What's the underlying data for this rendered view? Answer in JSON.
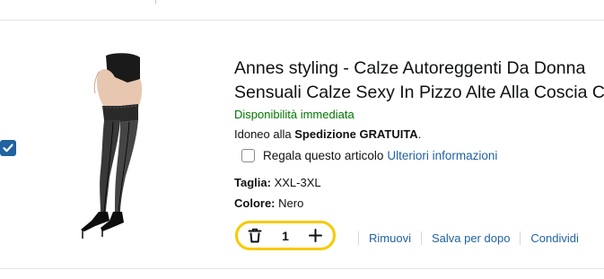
{
  "item": {
    "title_line1": "Annes styling - Calze Autoreggenti Da Donna",
    "title_line2": "Sensuali Calze Sexy In Pizzo Alte Alla Coscia C",
    "availability": "Disponibilità immediata",
    "shipping_prefix": "Idoneo alla ",
    "shipping_bold": "Spedizione GRATUITA",
    "shipping_suffix": ".",
    "gift_label": "Regala questo articolo",
    "gift_link": "Ulteriori informazioni",
    "size_label": "Taglia:",
    "size_value": "XXL-3XL",
    "color_label": "Colore:",
    "color_value": "Nero",
    "quantity": "1",
    "selected": true
  },
  "actions": {
    "remove": "Rimuovi",
    "save_later": "Salva per dopo",
    "share": "Condividi"
  },
  "colors": {
    "availability": "#007600",
    "link": "#2162a1",
    "stepper_border": "#f7ca00",
    "checkbox": "#2162a1"
  },
  "icons": {
    "delete": "trash-icon",
    "increment": "plus-icon",
    "checked": "checkmark-icon"
  }
}
